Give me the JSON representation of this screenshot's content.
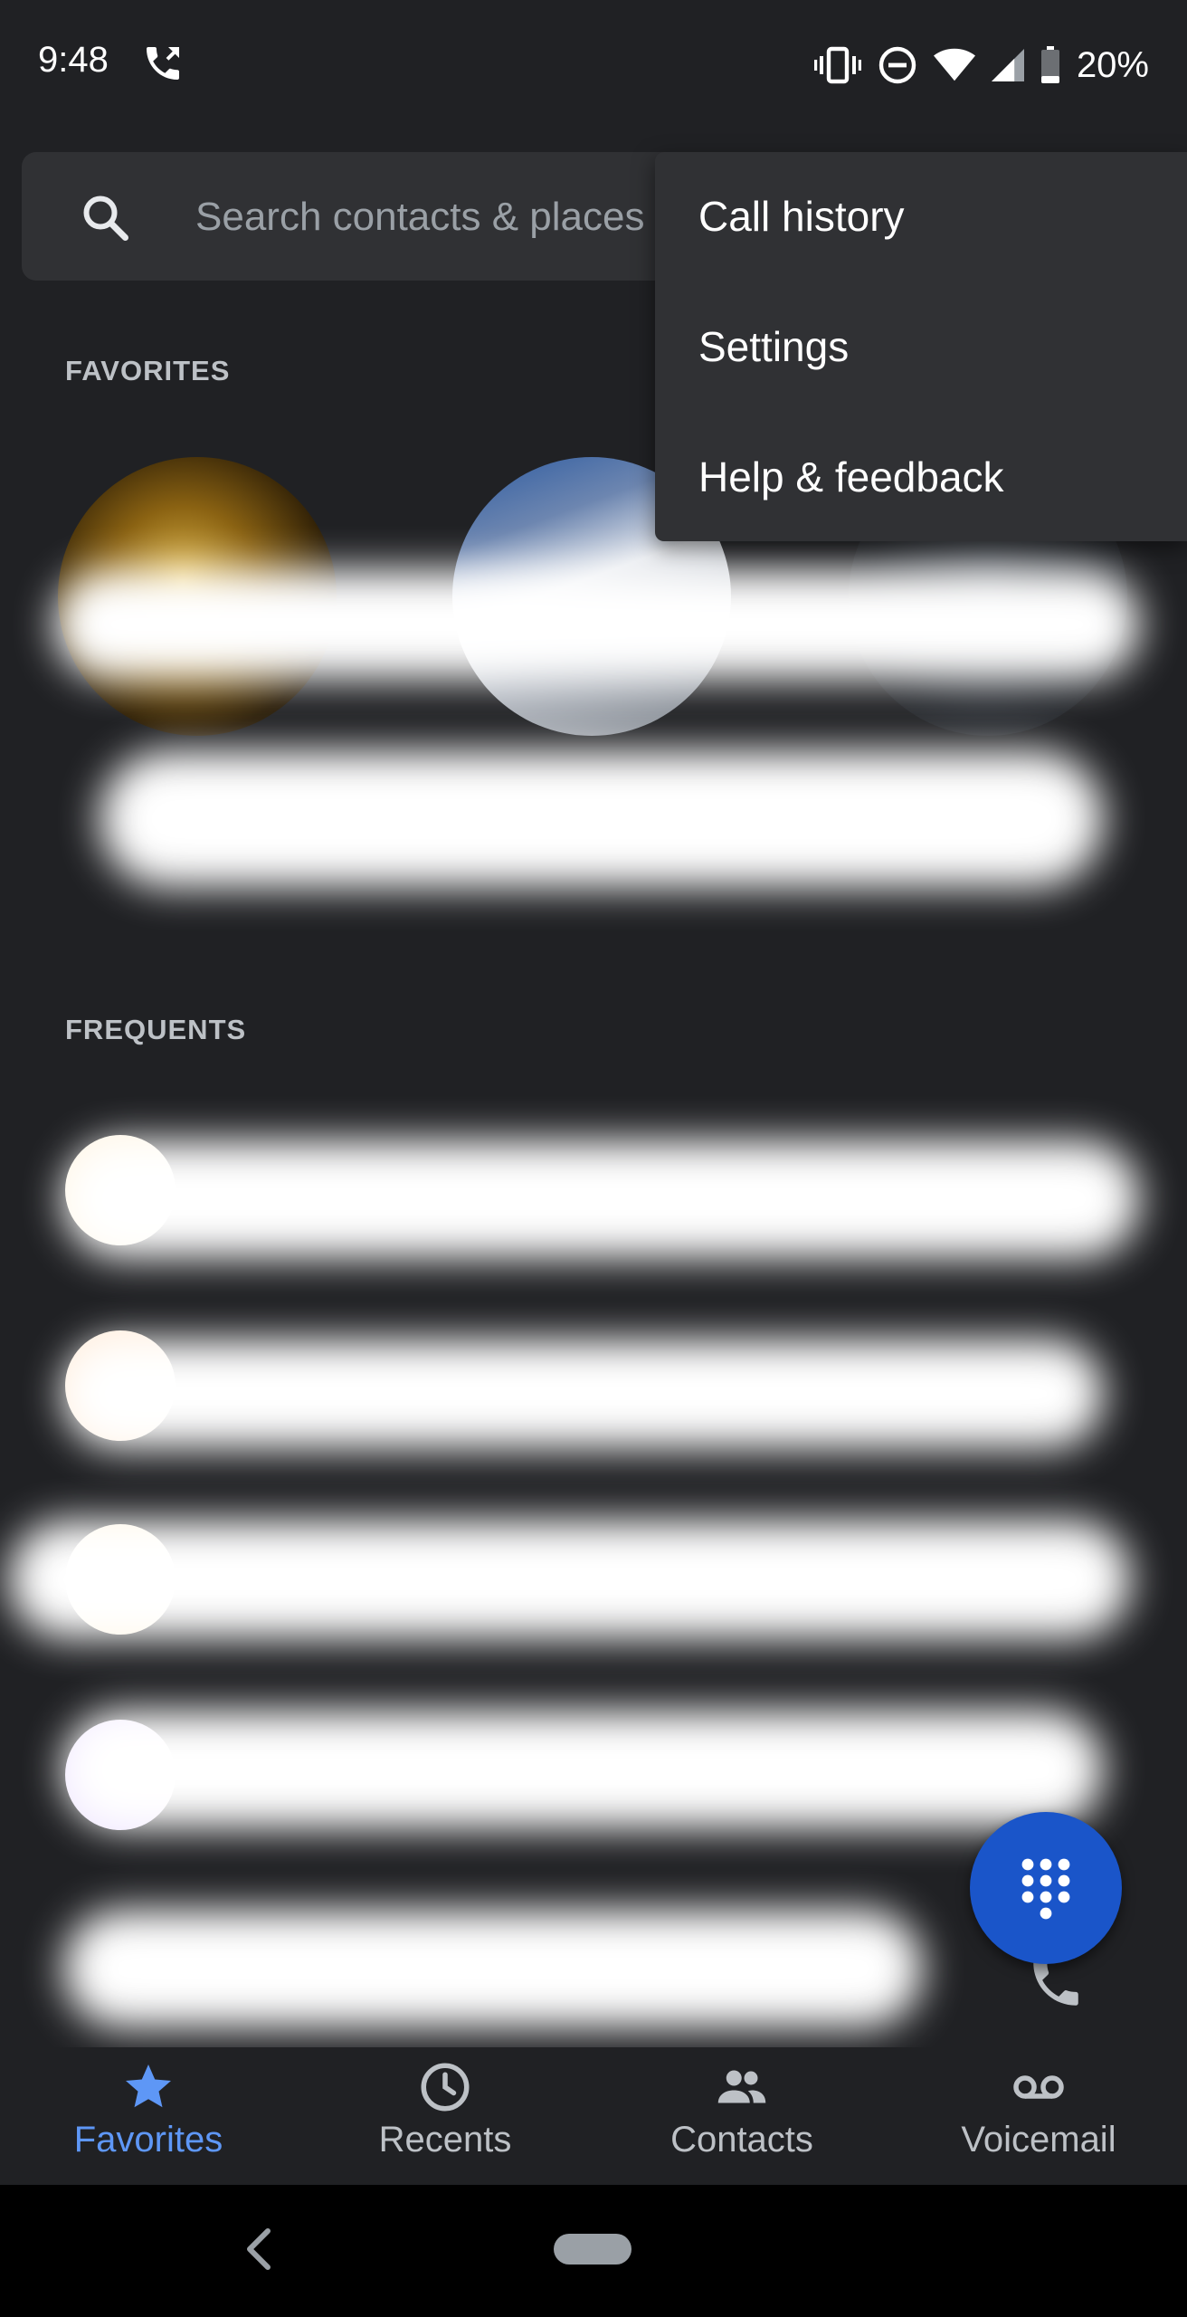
{
  "status_bar": {
    "time": "9:48",
    "battery": "20%"
  },
  "search": {
    "placeholder": "Search contacts & places"
  },
  "sections": {
    "favorites_label": "FAVORITES",
    "frequents_label": "FREQUENTS"
  },
  "overflow_menu": {
    "items": [
      {
        "label": "Call history"
      },
      {
        "label": "Settings"
      },
      {
        "label": "Help & feedback"
      }
    ]
  },
  "bottom_nav": {
    "items": [
      {
        "label": "Favorites",
        "icon": "star-icon",
        "active": true
      },
      {
        "label": "Recents",
        "icon": "clock-icon",
        "active": false
      },
      {
        "label": "Contacts",
        "icon": "people-icon",
        "active": false
      },
      {
        "label": "Voicemail",
        "icon": "voicemail-icon",
        "active": false
      }
    ]
  },
  "colors": {
    "background": "#202124",
    "surface": "#303134",
    "accent": "#5e97f6",
    "fab": "#1a55c9"
  }
}
